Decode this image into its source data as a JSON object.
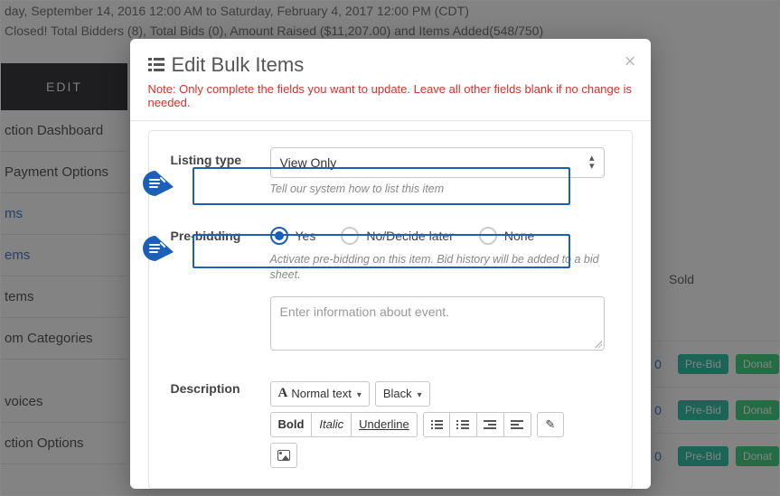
{
  "bg": {
    "dateline": "day, September 14, 2016 12:00 AM to Saturday, February 4, 2017 12:00 PM (CDT)",
    "statsline": "Closed! Total Bidders (8), Total Bids (0), Amount Raised ($11,207.00) and Items Added(548/750)",
    "tab": "EDIT",
    "sidebar": [
      {
        "label": "ction Dashboard",
        "active": false
      },
      {
        "label": " Payment Options",
        "active": false
      },
      {
        "label": "ms",
        "active": true
      },
      {
        "label": "ems",
        "active": true
      },
      {
        "label": "tems",
        "active": false
      },
      {
        "label": "om Categories",
        "active": false
      },
      {
        "label": "voices",
        "active": false
      },
      {
        "label": "ction Options",
        "active": false
      }
    ],
    "soldLabel": "Sold",
    "rows": [
      {
        "count": "0",
        "badge1": "Pre-Bid",
        "badge2": "Donat"
      },
      {
        "count": "0",
        "badge1": "Pre-Bid",
        "badge2": "Donat"
      },
      {
        "count": "0",
        "badge1": "Pre-Bid",
        "badge2": "Donat"
      }
    ]
  },
  "modal": {
    "title": "Edit Bulk Items",
    "note": "Note: Only complete the fields you want to update. Leave all other fields blank if no change is needed.",
    "listing": {
      "label": "Listing type",
      "value": "View Only",
      "help": "Tell our system how to list this item"
    },
    "prebid": {
      "label": "Pre-bidding",
      "options": [
        "Yes",
        "No/Decide later",
        "None"
      ],
      "selected": 0,
      "help": "Activate pre-bidding on this item. Bid history will be added to a bid sheet."
    },
    "info_placeholder": "Enter information about event.",
    "desc": {
      "label": "Description",
      "font": "Normal text",
      "color": "Black",
      "bold": "Bold",
      "italic": "Italic",
      "underline": "Underline"
    }
  }
}
